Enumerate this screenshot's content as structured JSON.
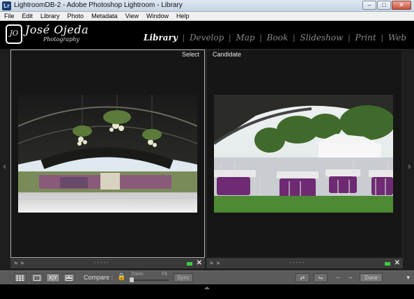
{
  "window": {
    "title": "LightroomDB-2 - Adobe Photoshop Lightroom - Library",
    "app_icon": "Lr",
    "controls": {
      "minimize": "–",
      "maximize": "□",
      "close": "✕"
    }
  },
  "menu": [
    "File",
    "Edit",
    "Library",
    "Photo",
    "Metadata",
    "View",
    "Window",
    "Help"
  ],
  "identity": {
    "mark": "JO",
    "name": "José Ojeda",
    "subtitle": "Photography"
  },
  "modules": {
    "items": [
      "Library",
      "Develop",
      "Map",
      "Book",
      "Slideshow",
      "Print",
      "Web"
    ],
    "active": "Library",
    "separator": "|"
  },
  "compare": {
    "select_label": "Select",
    "candidate_label": "Candidate",
    "select_photo": "event tent with hanging chandeliers and dance floor",
    "candidate_photo": "outdoor banquet tables with purple linens under tent"
  },
  "pane_footer": {
    "flags": "⚑ ⚑",
    "dots": "•••••",
    "close": "✕",
    "label_color": "#3fcc3f"
  },
  "toolbar": {
    "grid_view_icon": "grid-view-icon",
    "loupe_view_icon": "loupe-view-icon",
    "compare_view_text": "X|Y",
    "survey_view_icon": "survey-view-icon",
    "compare_label": "Compare :",
    "lock_icon": "🔒",
    "zoom_label": "Zoom",
    "fit_label": "Fit",
    "sync_label": "Sync",
    "swap_icon": "⇄",
    "make_select_icon": "⇋",
    "prev_arrow": "←",
    "next_arrow": "→",
    "done_label": "Done",
    "more_icon": "▾"
  }
}
